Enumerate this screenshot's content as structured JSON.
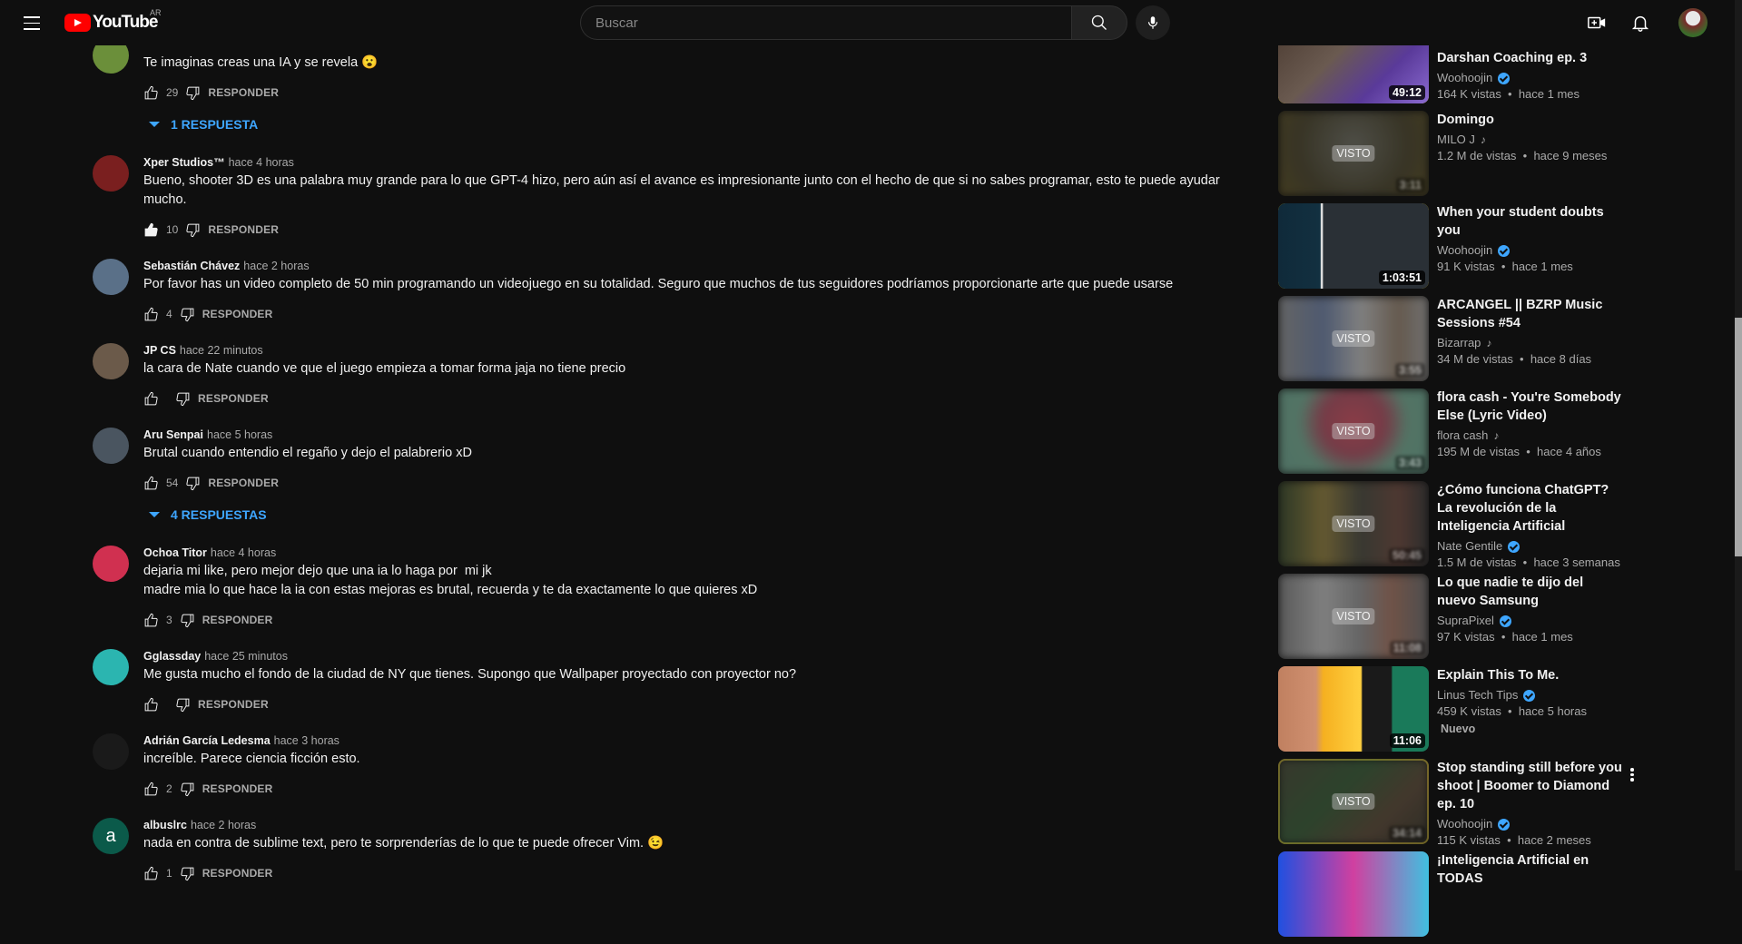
{
  "header": {
    "logo_text": "YouTube",
    "country_code": "AR",
    "search_placeholder": "Buscar",
    "icons": [
      "menu-icon",
      "search-icon",
      "microphone-icon",
      "create-video-icon",
      "bell-icon"
    ]
  },
  "colors": {
    "background": "#0f0f0f",
    "accent_blue": "#3ea6ff",
    "brand_red": "#ff0000"
  },
  "comments": [
    {
      "author": "",
      "time": "",
      "text": "Te imaginas creas una IA y se revela 😮",
      "likes": "29",
      "liked": false,
      "replies": "1 RESPUESTA",
      "avatar_color": "#6b8f3a"
    },
    {
      "author": "Xper Studios™",
      "time": "hace 4 horas",
      "text": "Bueno, shooter 3D es una palabra muy grande para lo que GPT-4 hizo, pero aún así el avance es impresionante junto con el hecho de que si no sabes programar, esto te puede ayudar mucho.",
      "likes": "10",
      "liked": true,
      "avatar_color": "#7a1f1f"
    },
    {
      "author": "Sebastián Chávez",
      "time": "hace 2 horas",
      "text": "Por favor has un video completo de 50 min programando un videojuego en su totalidad. Seguro que muchos de tus seguidores podríamos proporcionarte arte que puede usarse",
      "likes": "4",
      "liked": false,
      "avatar_color": "#5a7088"
    },
    {
      "author": "JP CS",
      "time": "hace 22 minutos",
      "text": "la cara de Nate cuando ve que el juego empieza a tomar forma jaja no tiene precio",
      "likes": "",
      "liked": false,
      "avatar_color": "#6b5a4a"
    },
    {
      "author": "Aru Senpai",
      "time": "hace 5 horas",
      "text": "Brutal cuando entendio el regaño y dejo el palabrerio xD",
      "likes": "54",
      "liked": false,
      "replies": "4 RESPUESTAS",
      "avatar_color": "#4a5560"
    },
    {
      "author": "Ochoa Titor",
      "time": "hace 4 horas",
      "text": "dejaria mi like, pero mejor dejo que una ia lo haga por  mi jk\nmadre mia lo que hace la ia con estas mejoras es brutal, recuerda y te da exactamente lo que quieres xD",
      "likes": "3",
      "liked": false,
      "avatar_color": "#d03050"
    },
    {
      "author": "Gglassday",
      "time": "hace 25 minutos",
      "text": "Me gusta mucho el fondo de la ciudad de NY que tienes. Supongo que Wallpaper proyectado con proyector no?",
      "likes": "",
      "liked": false,
      "avatar_color": "#2bb5b0"
    },
    {
      "author": "Adrián García Ledesma",
      "time": "hace 3 horas",
      "text": "increíble. Parece ciencia ficción esto.",
      "likes": "2",
      "liked": false,
      "avatar_color": "#1a1a1a"
    },
    {
      "author": "albuslrc",
      "time": "hace 2 horas",
      "text": "nada en contra de sublime text, pero te sorprenderías de lo que te puede ofrecer Vim. 😉",
      "likes": "1",
      "liked": false,
      "avatar_letter": "a",
      "avatar_color": "#0b5a4a"
    }
  ],
  "reply_label": "RESPONDER",
  "related": [
    {
      "title": "Darshan Coaching ep. 3",
      "channel": "Woohoojin",
      "verified": true,
      "views": "164 K vistas",
      "age": "hace 1 mes",
      "duration": "49:12",
      "watched": false,
      "title_cut": true,
      "thumb": "linear-gradient(135deg,#4a3a30 0%,#6a5a50 40%,#5a3a9a 70%,#8a6ad0 100%)",
      "border": "#f5d800"
    },
    {
      "title": "Domingo",
      "channel": "MILO J",
      "artist": true,
      "views": "1.2 M de vistas",
      "age": "hace 9 meses",
      "duration": "3:11",
      "watched": true,
      "seen_label": "VISTO",
      "thumb": "radial-gradient(circle at 50% 40%,#6a6a60,#4a4530 60%,#5a5028)"
    },
    {
      "title": "When your student doubts you",
      "channel": "Woohoojin",
      "verified": true,
      "views": "91 K vistas",
      "age": "hace 1 mes",
      "duration": "1:03:51",
      "watched": false,
      "thumb": "linear-gradient(90deg,#102a3a 0%,#123040 28%,#e0e0e0 28.5%,#e0e0e0 29.5%,#2a3036 30%,#2a3036 100%)",
      "border": "#f5d800"
    },
    {
      "title": "ARCANGEL || BZRP Music Sessions #54",
      "channel": "Bizarrap",
      "artist": true,
      "views": "34 M de vistas",
      "age": "hace 8 días",
      "duration": "3:55",
      "watched": true,
      "seen_label": "VISTO",
      "thumb": "linear-gradient(90deg,#8a8a8a,#6a7a9a 30%,#b0b0b0 55%,#8a7a6a 80%,#9a9a9a)"
    },
    {
      "title": "flora cash - You're Somebody Else (Lyric Video)",
      "channel": "flora cash",
      "artist": true,
      "views": "195 M de vistas",
      "age": "hace 4 años",
      "duration": "3:43",
      "watched": true,
      "seen_label": "VISTO",
      "thumb": "radial-gradient(circle at 50% 40%,#c05060 0%,#a05060 35%,#70a08a 60%,#6a9a88)"
    },
    {
      "title": "¿Cómo funciona ChatGPT? La revolución de la Inteligencia Artificial",
      "channel": "Nate Gentile",
      "verified": true,
      "views": "1.5 M de vistas",
      "age": "hace 3 semanas",
      "duration": "50:45",
      "watched": true,
      "seen_label": "VISTO",
      "thumb": "linear-gradient(90deg,#3a4a30,#8a7a40 30%,#4a4a40 55%,#6a4a40 80%,#3a3a3a)"
    },
    {
      "title": "Lo que nadie te dijo del nuevo Samsung",
      "channel": "SupraPixel",
      "verified": true,
      "views": "97 K vistas",
      "age": "hace 1 mes",
      "duration": "11:08",
      "watched": true,
      "seen_label": "VISTO",
      "thumb": "linear-gradient(90deg,#7a7a7a,#b0b0b0 30%,#8a8a8a 55%,#9a7060 75%,#6a6a6a)"
    },
    {
      "title": "Explain This To Me.",
      "channel": "Linus Tech Tips",
      "verified": true,
      "views": "459 K vistas",
      "age": "hace 5 horas",
      "badge": "Nuevo",
      "duration": "11:06",
      "watched": false,
      "thumb": "linear-gradient(90deg,#c08060 0%,#d09070 25%,#f5b020 30%,#ffd040 55%,#1a1a1a 56%,#1a1a1a 75%,#1a7a5a 76%,#1a7a5a)"
    },
    {
      "title": "Stop standing still before you shoot | Boomer to Diamond ep. 10",
      "channel": "Woohoojin",
      "verified": true,
      "views": "115 K vistas",
      "age": "hace 2 meses",
      "duration": "34:14",
      "watched": true,
      "seen_label": "VISTO",
      "thumb": "linear-gradient(135deg,#4a4a3a,#3a5a3a 40%,#5a4a3a 70%,#3a3a30)",
      "border": "#8a7a20",
      "menu": true
    },
    {
      "title": "¡Inteligencia Artificial en TODAS",
      "channel": "",
      "views": "",
      "age": "",
      "watched": false,
      "thumb": "linear-gradient(90deg,#2050e0,#d040a0 50%,#40c0e0)"
    }
  ]
}
